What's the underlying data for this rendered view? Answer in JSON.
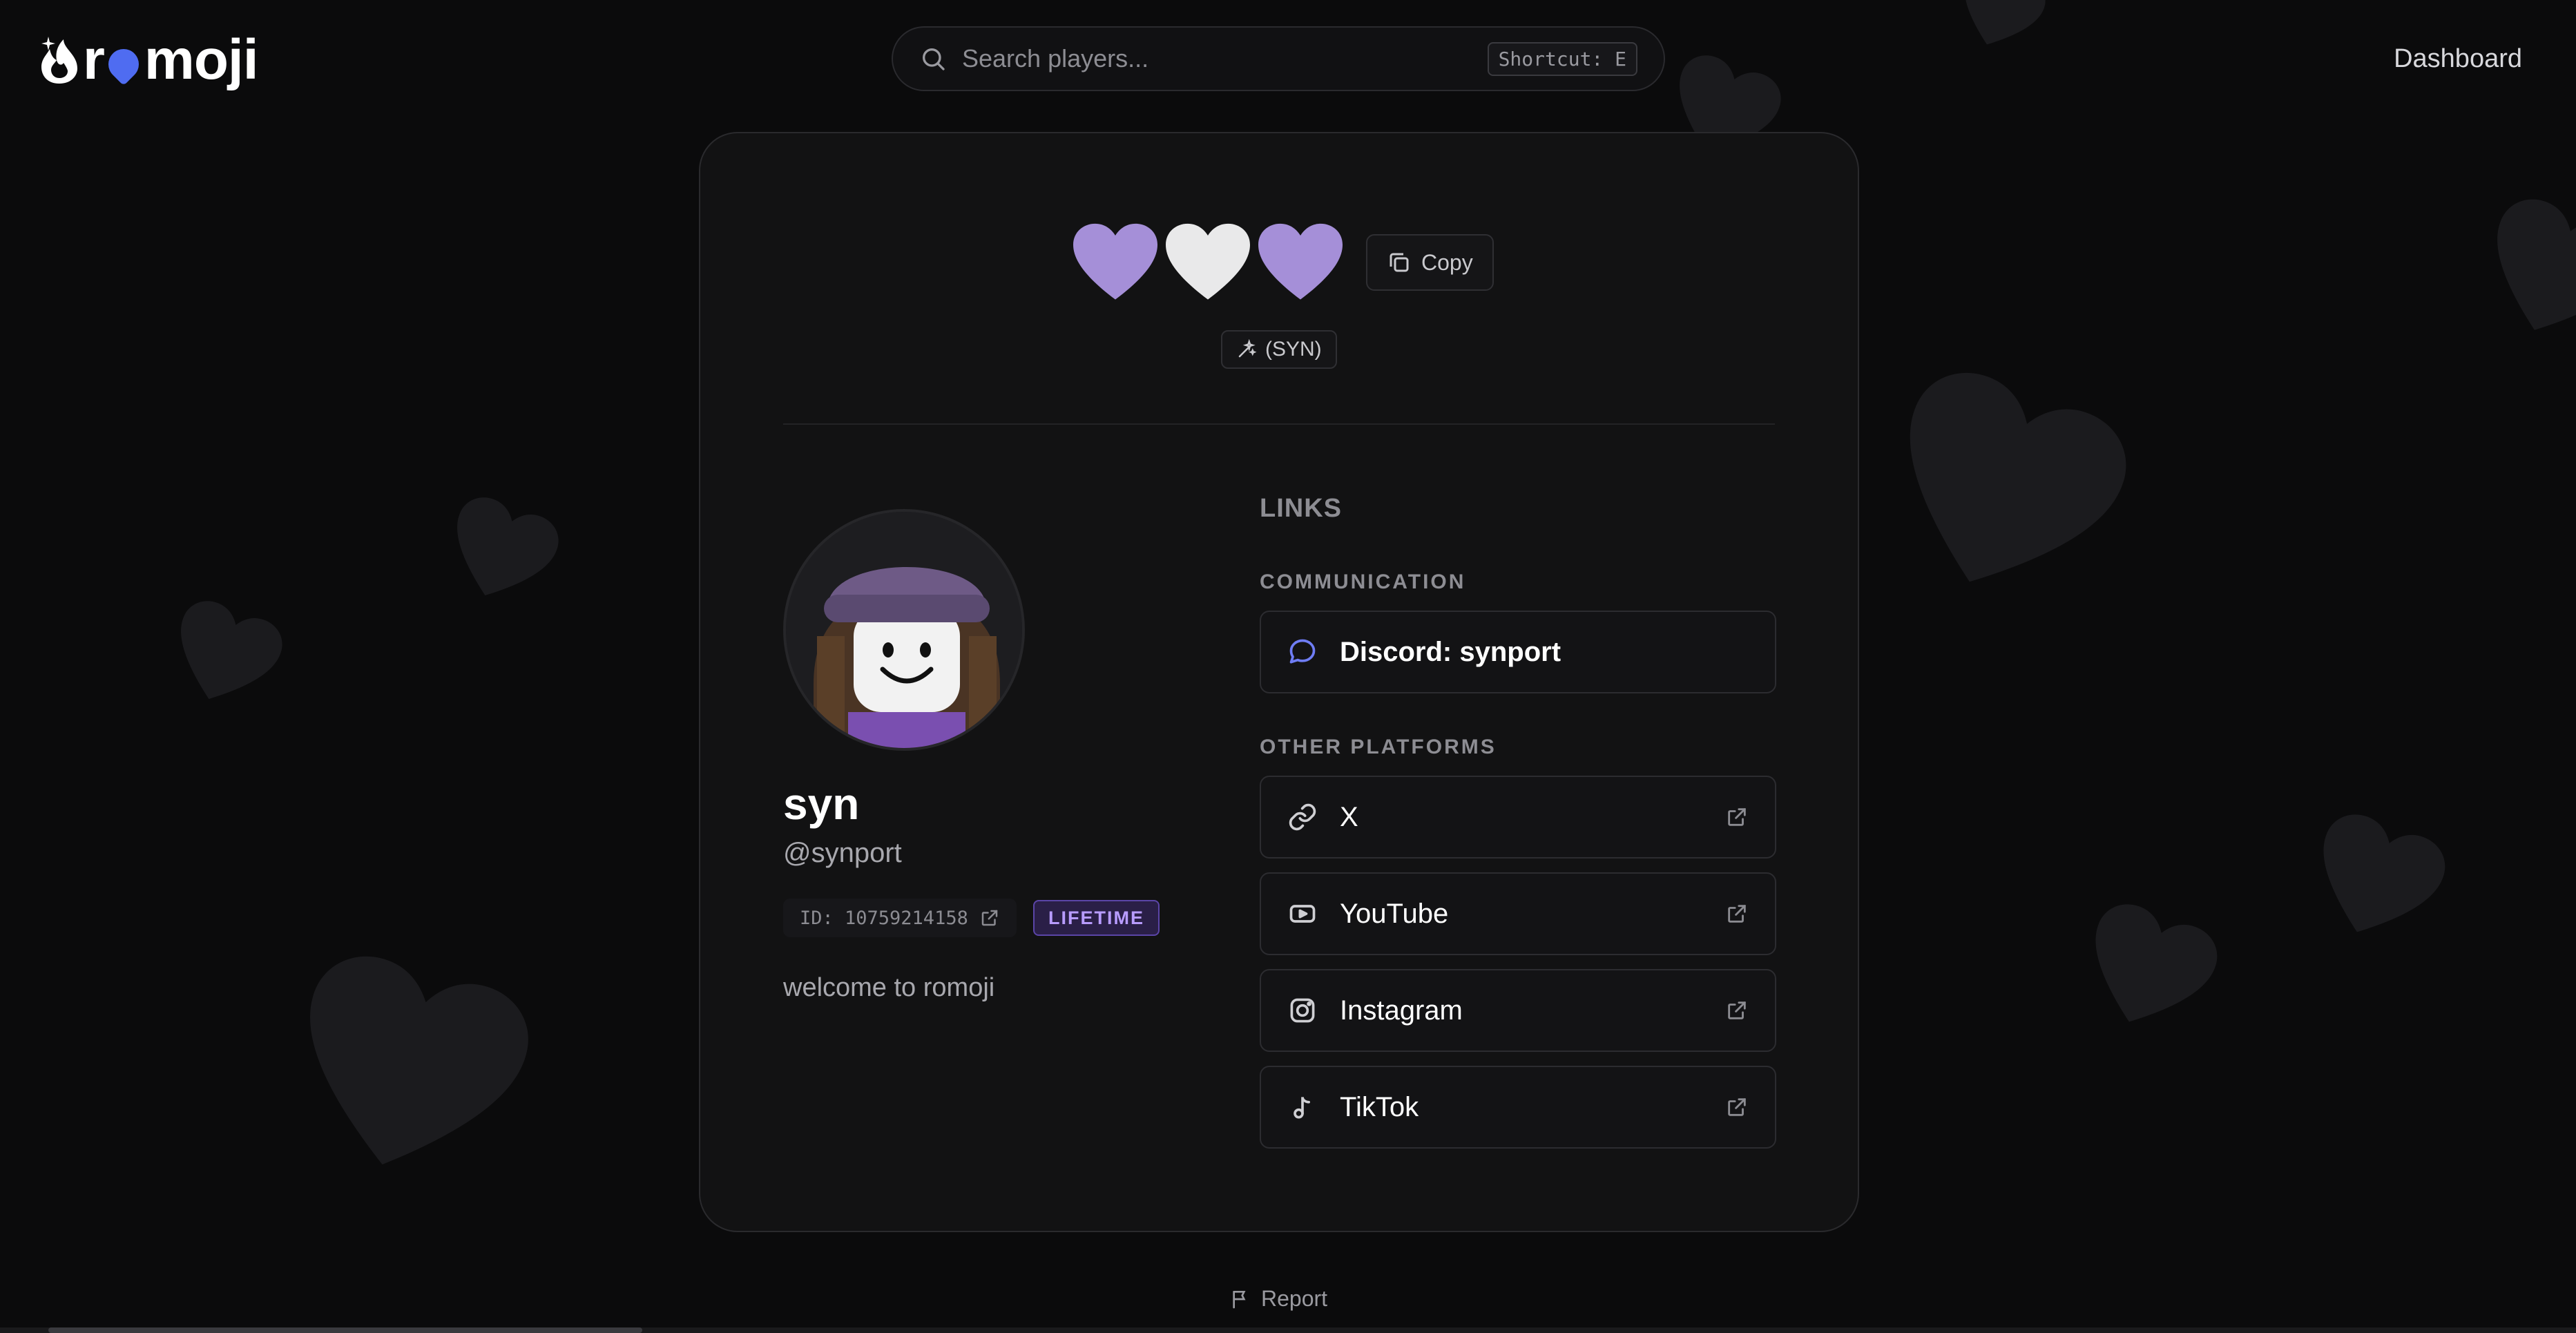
{
  "brand": {
    "logo_text_prefix": "r",
    "logo_text_suffix": "moji",
    "accent_color": "#4f6cf1"
  },
  "header": {
    "search_placeholder": "Search players...",
    "search_shortcut": "Shortcut: E",
    "dashboard_label": "Dashboard"
  },
  "emoji_set": {
    "hearts": [
      {
        "icon": "purple-heart-icon",
        "color": "#a58fd8"
      },
      {
        "icon": "white-heart-icon",
        "color": "#e9e9ea"
      },
      {
        "icon": "purple-heart-icon",
        "color": "#a58fd8"
      }
    ],
    "copy_label": "Copy",
    "tag_label": "(SYN)"
  },
  "profile": {
    "display_name": "syn",
    "username": "@synport",
    "id_label": "ID: 10759214158",
    "badge": "LIFETIME",
    "bio": "welcome to romoji"
  },
  "links": {
    "heading": "LINKS",
    "communication_label": "COMMUNICATION",
    "discord_label": "Discord: synport",
    "other_label": "OTHER PLATFORMS",
    "platforms": [
      {
        "label": "X",
        "icon": "link-icon"
      },
      {
        "label": "YouTube",
        "icon": "youtube-icon"
      },
      {
        "label": "Instagram",
        "icon": "instagram-icon"
      },
      {
        "label": "TikTok",
        "icon": "tiktok-icon"
      }
    ]
  },
  "footer": {
    "report_label": "Report"
  }
}
